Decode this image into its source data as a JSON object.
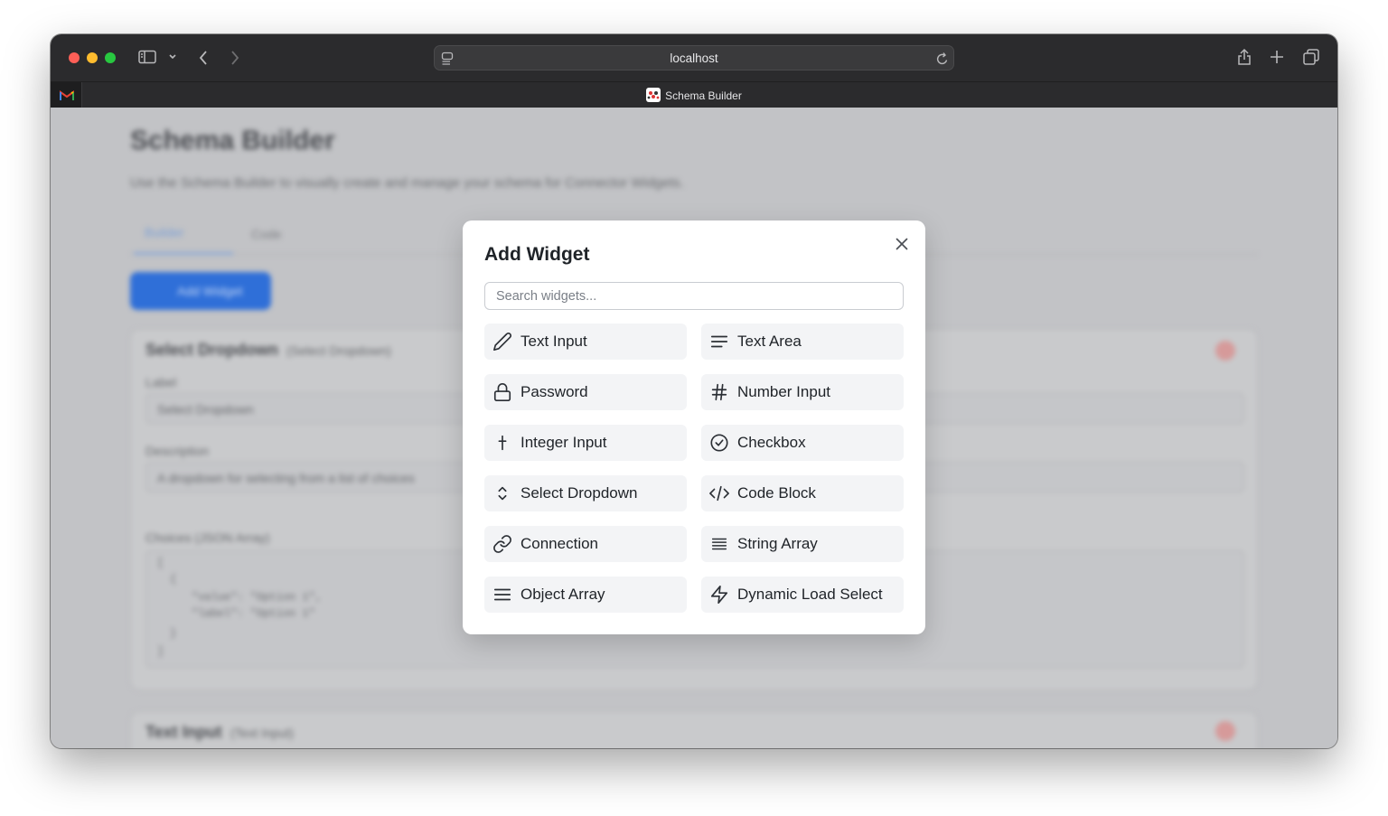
{
  "browser": {
    "url": "localhost",
    "tab_title": "Schema Builder",
    "pinned_tab_icon": "gmail-icon"
  },
  "page": {
    "title": "Schema Builder",
    "subtitle": "Use the Schema Builder to visually create and manage your schema for Connector Widgets.",
    "tabs": [
      {
        "label": "Builder",
        "active": true
      },
      {
        "label": "Code",
        "active": false
      }
    ],
    "add_button_label": "Add Widget",
    "cards": [
      {
        "title": "Select Dropdown",
        "subtitle": "(Select Dropdown)",
        "fields": [
          {
            "label": "Label",
            "value": "Select Dropdown"
          },
          {
            "label": "Description",
            "value": "A dropdown for selecting from a list of choices"
          },
          {
            "label": "Choices (JSON Array)",
            "value": ""
          }
        ],
        "code_preview": [
          "[",
          "{",
          "\"value\": \"Option 1\",",
          "\"label\": \"Option 1\"",
          "}",
          "]"
        ]
      },
      {
        "title": "Text Input",
        "subtitle": "(Text Input)"
      }
    ]
  },
  "modal": {
    "title": "Add Widget",
    "search_placeholder": "Search widgets...",
    "widgets": [
      {
        "label": "Text Input",
        "icon": "pencil-icon"
      },
      {
        "label": "Text Area",
        "icon": "text-lines-icon"
      },
      {
        "label": "Password",
        "icon": "lock-icon"
      },
      {
        "label": "Number Input",
        "icon": "hash-icon"
      },
      {
        "label": "Integer Input",
        "icon": "plus-icon"
      },
      {
        "label": "Checkbox",
        "icon": "check-circle-icon"
      },
      {
        "label": "Select Dropdown",
        "icon": "chevrons-up-down-icon"
      },
      {
        "label": "Code Block",
        "icon": "code-icon"
      },
      {
        "label": "Connection",
        "icon": "link-icon"
      },
      {
        "label": "String Array",
        "icon": "list-icon"
      },
      {
        "label": "Object Array",
        "icon": "menu-icon"
      },
      {
        "label": "Dynamic Load Select",
        "icon": "zap-icon"
      }
    ]
  },
  "colors": {
    "primary": "#2f6fd8",
    "danger": "#d69a9a",
    "widget_bg": "#f3f4f6"
  }
}
